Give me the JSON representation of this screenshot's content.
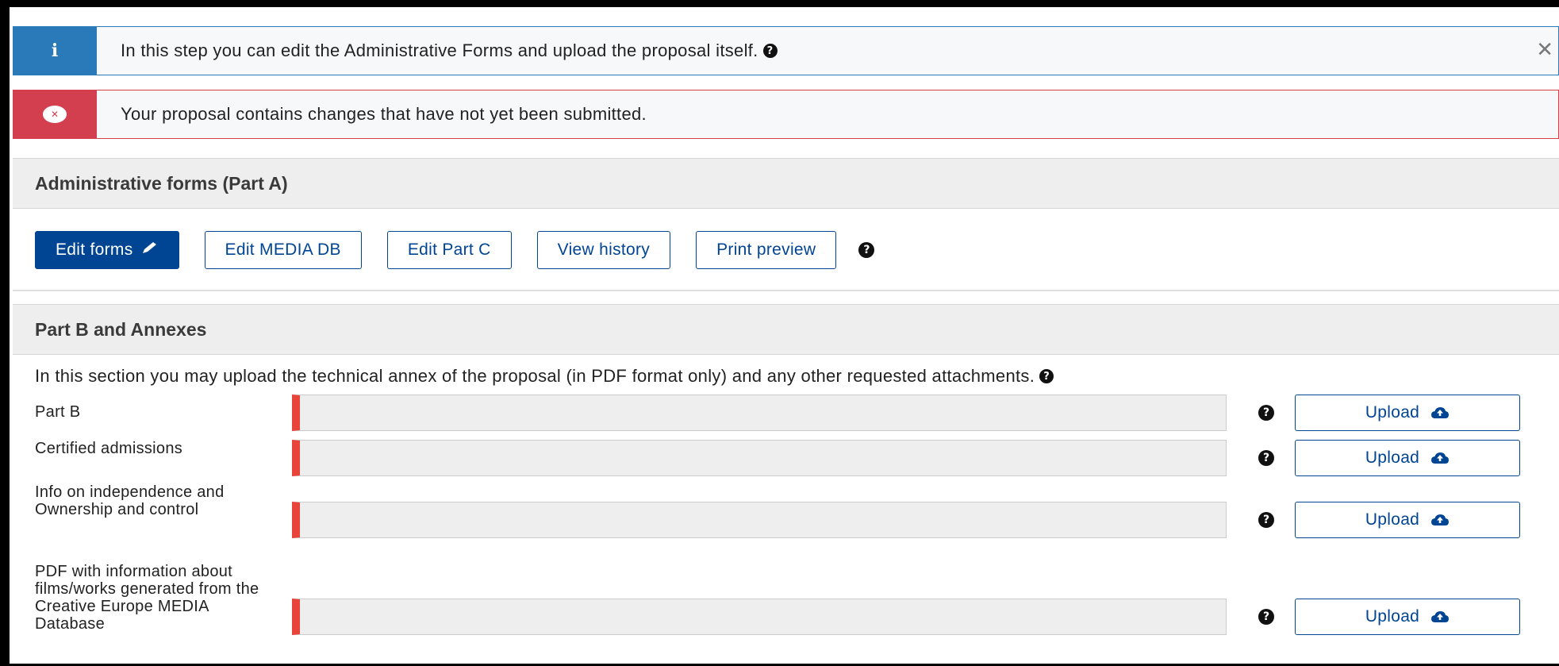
{
  "alerts": {
    "info": {
      "text": "In this step you can edit the Administrative Forms and upload the proposal itself.",
      "icon": "info-icon",
      "close_label": "✕"
    },
    "error": {
      "text": "Your proposal contains changes that have not yet been submitted.",
      "icon": "error-icon"
    }
  },
  "admin_forms": {
    "title": "Administrative forms (Part A)",
    "buttons": {
      "edit_forms": "Edit forms",
      "edit_media_db": "Edit MEDIA DB",
      "edit_part_c": "Edit Part C",
      "view_history": "View history",
      "print_preview": "Print preview"
    }
  },
  "part_b": {
    "title": "Part B and Annexes",
    "intro": "In this section you may upload the technical annex of the proposal (in PDF format only) and any other requested attachments.",
    "rows": [
      {
        "label": "Part B",
        "upload_label": "Upload"
      },
      {
        "label": "Certified admissions",
        "upload_label": "Upload"
      },
      {
        "label": "Info on independence and Ownership and control",
        "upload_label": "Upload"
      },
      {
        "label": "PDF with information about films/works generated from the Creative Europe MEDIA Database",
        "upload_label": "Upload"
      }
    ]
  },
  "colors": {
    "primary": "#004494",
    "info": "#2a7ab9",
    "error": "#d43f4f",
    "required_marker": "#e8443a"
  }
}
